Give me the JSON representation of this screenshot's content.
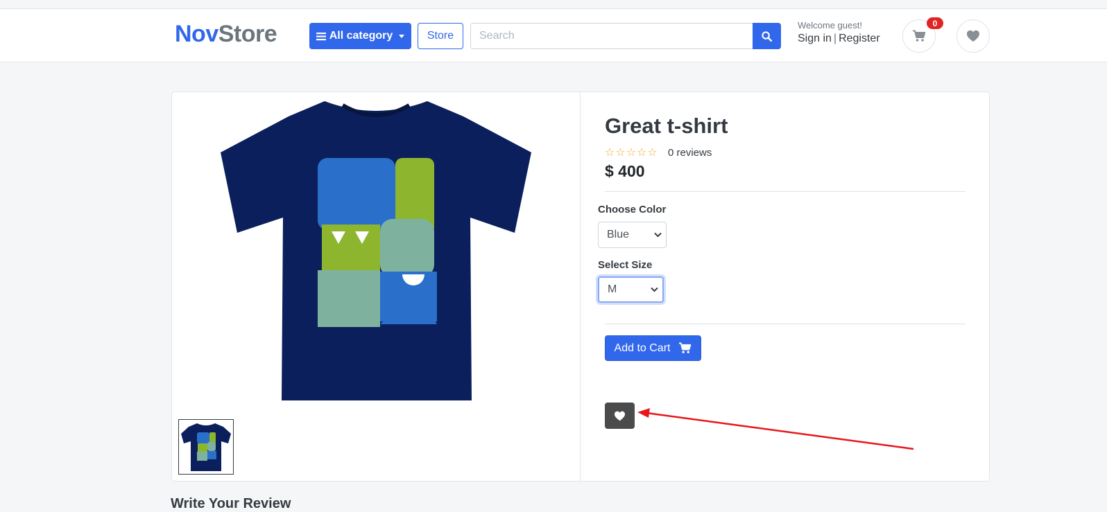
{
  "header": {
    "logo_part1": "Nov",
    "logo_part2": "Store",
    "category_label": "All category",
    "store_label": "Store",
    "search_placeholder": "Search",
    "welcome_text": "Welcome guest!",
    "sign_in_label": "Sign in",
    "separator": "|",
    "register_label": "Register",
    "cart_count": "0",
    "icons": [
      "menu-icon",
      "search-icon",
      "cart-icon",
      "heart-icon"
    ]
  },
  "product": {
    "title": "Great t-shirt",
    "stars": "☆☆☆☆☆",
    "rating": 0,
    "reviews_text": "0 reviews",
    "price": "$ 400",
    "color_label": "Choose Color",
    "color_value": "Blue",
    "size_label": "Select Size",
    "size_value": "M",
    "add_to_cart_label": "Add to Cart"
  },
  "review_section": {
    "heading": "Write Your Review"
  },
  "colors": {
    "primary": "#3167eb",
    "dark_button": "#4b4b4b",
    "badge": "#e02424",
    "star": "#f5a623",
    "annotation_arrow": "#e8161a",
    "shirt": "#0b1f5c"
  }
}
